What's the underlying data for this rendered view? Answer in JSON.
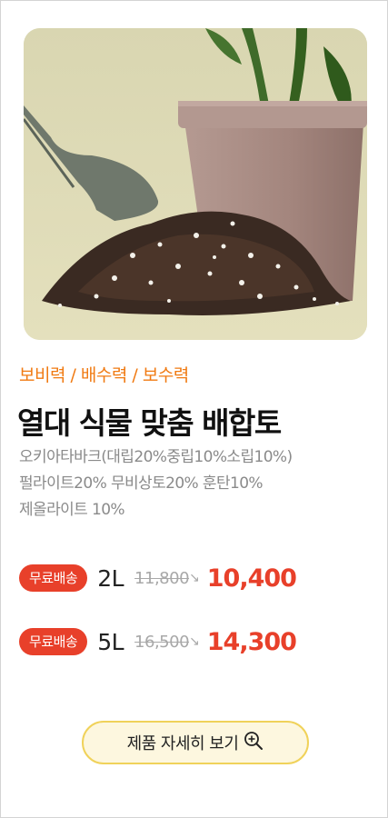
{
  "product": {
    "tags": "보비력 / 배수력 / 보수력",
    "title": "열대 식물 맞춤 배합토",
    "description": [
      "오키아타바크(대립20%중립10%소립10%)",
      "펄라이트20% 무비상토20% 훈탄10%",
      "제올라이트 10%"
    ]
  },
  "prices": [
    {
      "badge": "무료배송",
      "size": "2L",
      "old_price": "11,800",
      "arrow": "↘",
      "new_price": "10,400"
    },
    {
      "badge": "무료배송",
      "size": "5L",
      "old_price": "16,500",
      "arrow": "↘",
      "new_price": "14,300"
    }
  ],
  "detail_button": {
    "label": "제품 자세히 보기",
    "icon": "zoom-in-icon"
  },
  "colors": {
    "accent": "#e8402a",
    "tag": "#f07a12",
    "button_border": "#f0d25a",
    "button_bg": "#fdf7df"
  }
}
